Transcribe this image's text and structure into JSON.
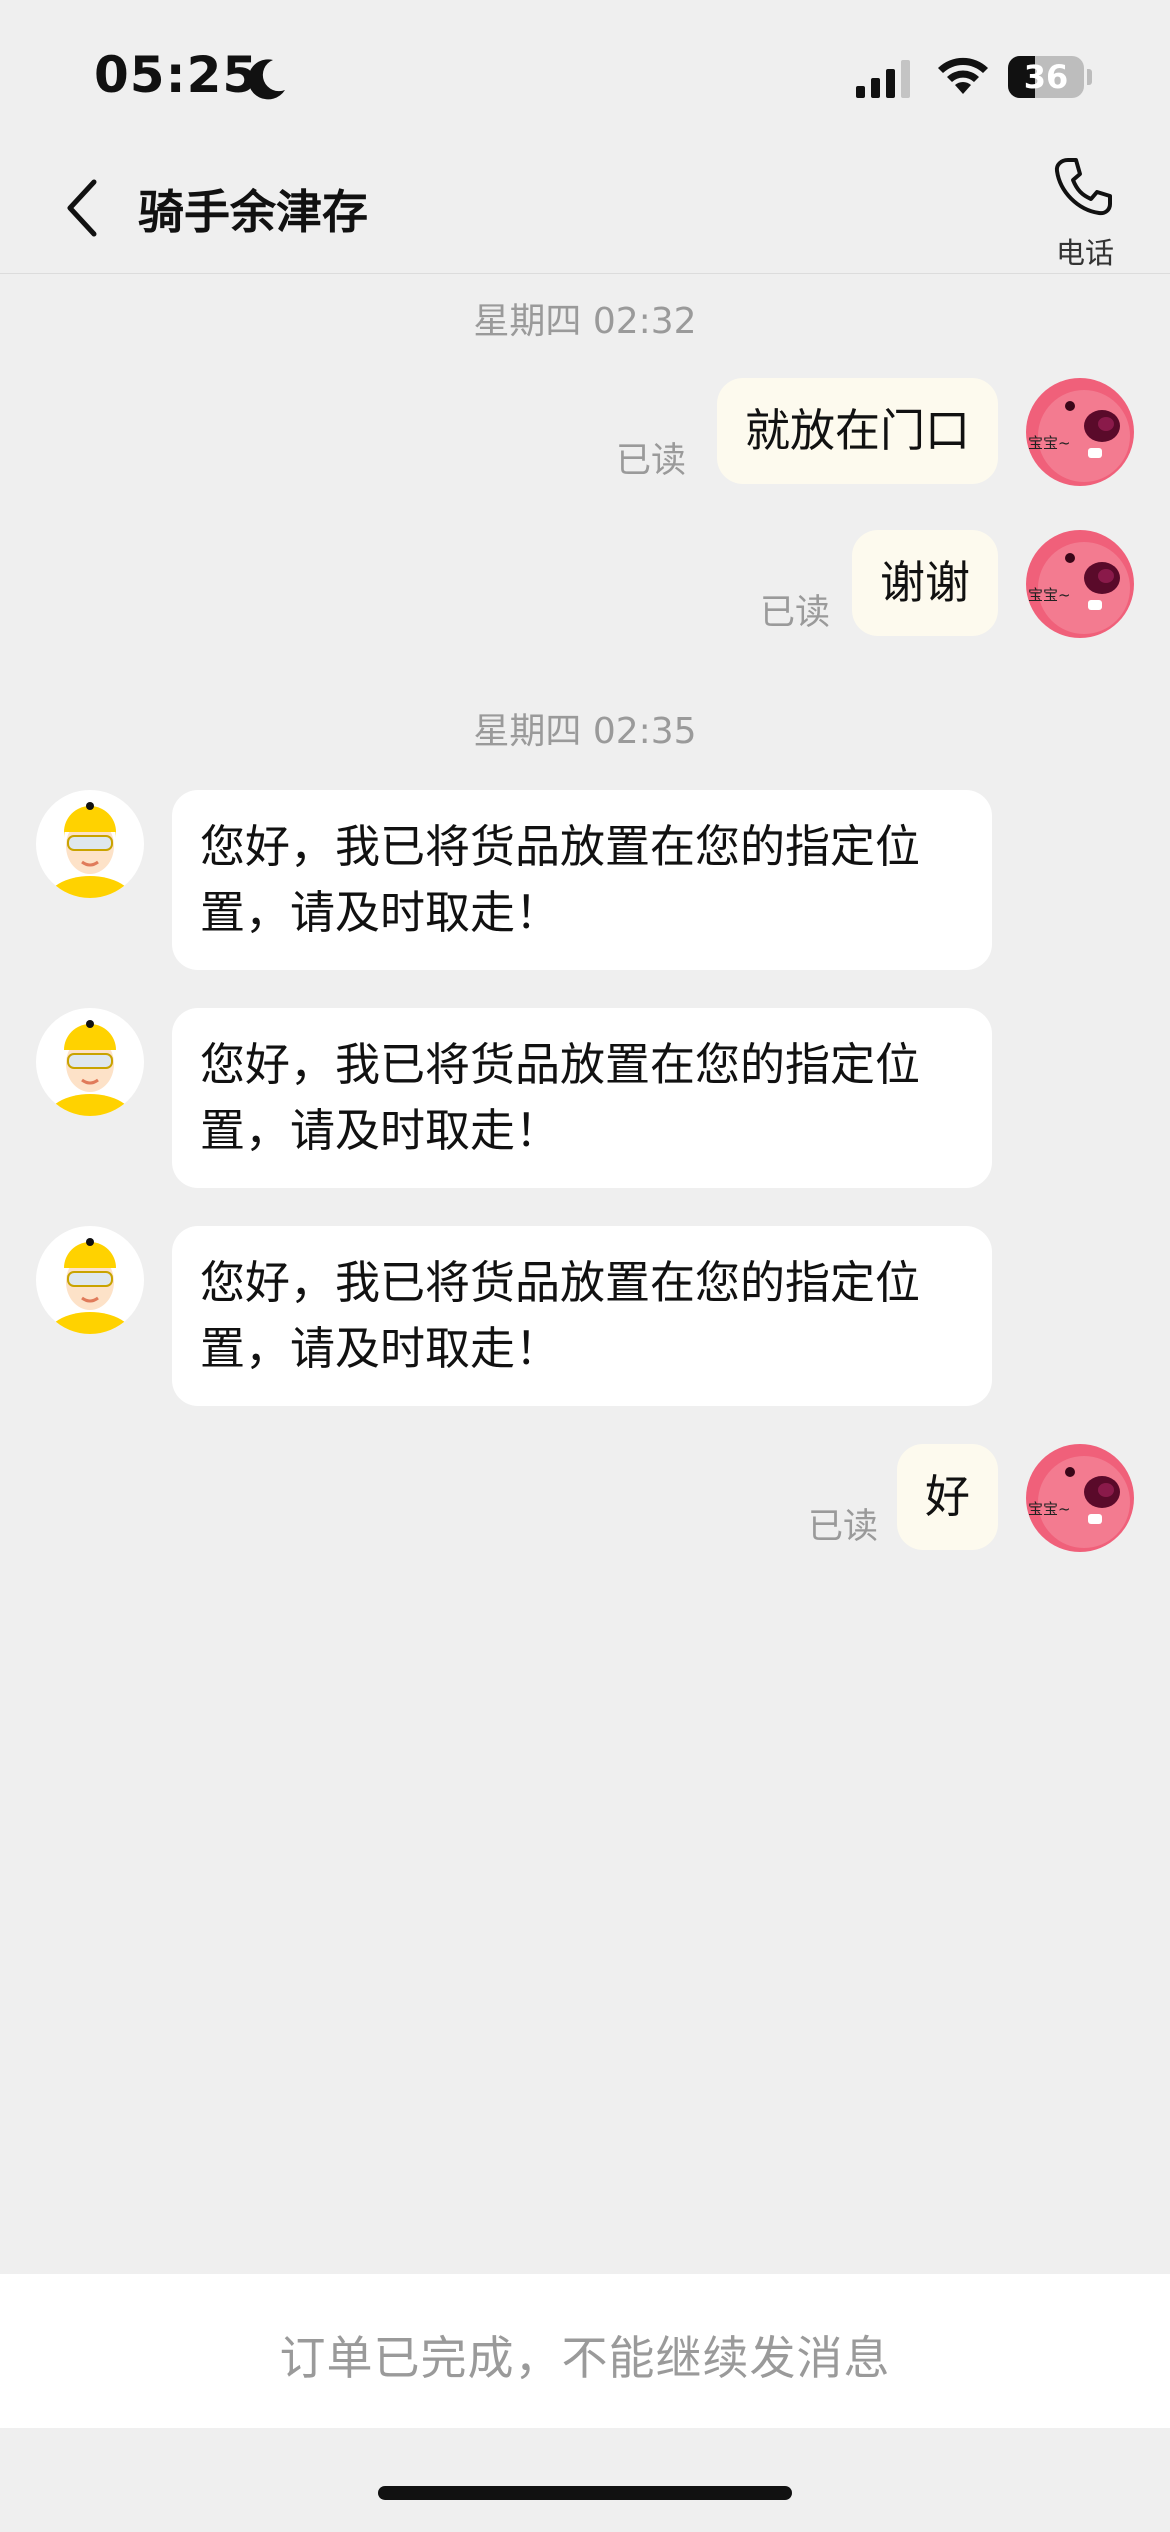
{
  "status_bar": {
    "time": "05:25",
    "battery_level": "36",
    "battery_fraction": 0.36,
    "icons": [
      "moon-icon",
      "signal-icon",
      "wifi-icon",
      "battery-icon"
    ]
  },
  "header": {
    "title": "骑手余津存",
    "back_icon": "chevron-left-icon",
    "phone_label": "电话",
    "phone_icon": "phone-icon"
  },
  "chat": {
    "separators": [
      "星期四 02:32",
      "星期四 02:35"
    ],
    "read_label": "已读",
    "messages": [
      {
        "from": "me",
        "text": "就放在门口",
        "status": "已读"
      },
      {
        "from": "me",
        "text": "谢谢",
        "status": "已读"
      },
      {
        "from": "rider",
        "text": "您好，我已将货品放置在您的指定位置，请及时取走！"
      },
      {
        "from": "rider",
        "text": "您好，我已将货品放置在您的指定位置，请及时取走！"
      },
      {
        "from": "rider",
        "text": "您好，我已将货品放置在您的指定位置，请及时取走！"
      },
      {
        "from": "me",
        "text": "好",
        "status": "已读"
      }
    ],
    "my_avatar_caption": "宝宝~"
  },
  "footer": {
    "notice": "订单已完成，不能继续发消息"
  },
  "colors": {
    "background": "#efefef",
    "out_bubble": "#fdfaee",
    "in_bubble": "#ffffff",
    "muted_text": "#9a9a9a",
    "rider_yellow": "#ffd200",
    "avatar_pink": "#f0607a"
  }
}
